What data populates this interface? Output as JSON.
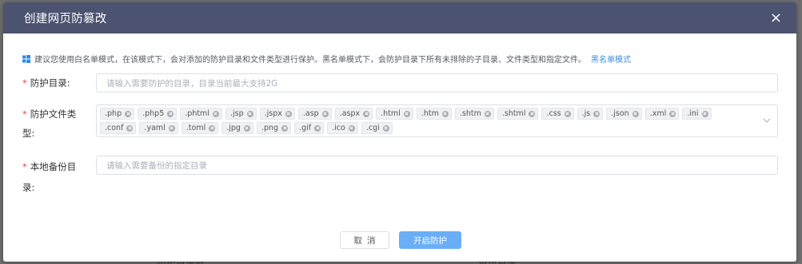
{
  "dialog": {
    "title": "创建网页防篡改",
    "close": "×"
  },
  "notice": {
    "text": "建议您使用白名单模式，在该模式下，会对添加的防护目录和文件类型进行保护。黑名单模式下，会防护目录下所有未排除的子目录、文件类型和指定文件。",
    "link": "黑名单模式"
  },
  "form": {
    "required_mark": "*",
    "protect_dir": {
      "label": "防护目录:",
      "placeholder": "请输入需要防护的目录，目录当前最大支持2G"
    },
    "file_types": {
      "label_line1": "防护文件类",
      "label_line2": "型:",
      "tags": [
        ".php",
        ".php5",
        ".phtml",
        ".jsp",
        ".jspx",
        ".asp",
        ".aspx",
        ".html",
        ".htm",
        ".shtm",
        ".shtml",
        ".css",
        ".js",
        ".json",
        ".xml",
        ".ini",
        ".conf",
        ".yaml",
        ".toml",
        ".jpg",
        ".png",
        ".gif",
        ".ico",
        ".cgi"
      ]
    },
    "backup_dir": {
      "label_line1": "本地备份目",
      "label_line2": "录:",
      "placeholder": "请输入需要备份的指定目录"
    }
  },
  "buttons": {
    "cancel": "取消",
    "submit": "开启防护"
  },
  "backdrop": {
    "left_text": "防护目录数",
    "right_text": "备份目录"
  },
  "colors": {
    "header": "#4b5370",
    "primary": "#69aef7",
    "link": "#3a8ee6",
    "required": "#e34a4a"
  }
}
